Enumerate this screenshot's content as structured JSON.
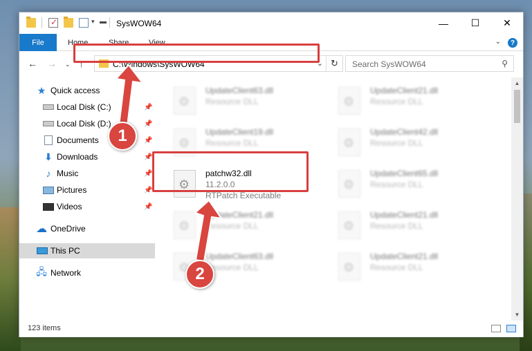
{
  "window": {
    "title": "SysWOW64"
  },
  "ribbon": {
    "file_label": "File",
    "tabs": [
      "Home",
      "Share",
      "View"
    ]
  },
  "address": {
    "path": "C:\\Windows\\SysWOW64"
  },
  "search": {
    "placeholder": "Search SysWOW64"
  },
  "sidebar": {
    "quick_access": "Quick access",
    "items": [
      {
        "label": "Local Disk (C:)",
        "icon": "disk-icon"
      },
      {
        "label": "Local Disk (D:)",
        "icon": "disk-icon"
      },
      {
        "label": "Documents",
        "icon": "documents-icon"
      },
      {
        "label": "Downloads",
        "icon": "downloads-icon"
      },
      {
        "label": "Music",
        "icon": "music-icon"
      },
      {
        "label": "Pictures",
        "icon": "pictures-icon"
      },
      {
        "label": "Videos",
        "icon": "videos-icon"
      }
    ],
    "onedrive": "OneDrive",
    "this_pc": "This PC",
    "network": "Network"
  },
  "files": {
    "left": [
      {
        "name": "UpdateClient63.dll",
        "desc": "Resource DLL"
      },
      {
        "name": "UpdateClient19.dll",
        "desc": "Resource DLL"
      },
      {
        "name": "patchw32.dll",
        "version": "11.2.0.0",
        "desc": "RTPatch Executable"
      },
      {
        "name": "UpdateClient21.dll",
        "desc": "Resource DLL"
      },
      {
        "name": "UpdateClient63.dll",
        "desc": "Resource DLL"
      }
    ],
    "right": [
      {
        "name": "UpdateClient21.dll",
        "desc": "Resource DLL"
      },
      {
        "name": "UpdateClient42.dll",
        "desc": "Resource DLL"
      },
      {
        "name": "UpdateClient65.dll",
        "desc": "Resource DLL"
      },
      {
        "name": "UpdateClient21.dll",
        "desc": "Resource DLL"
      },
      {
        "name": "UpdateClient21.dll",
        "desc": "Resource DLL"
      }
    ]
  },
  "status": {
    "items_count": "123 items"
  },
  "callouts": [
    "1",
    "2"
  ],
  "colors": {
    "accent": "#1979ca",
    "highlight": "#d83f3f",
    "selected": "#d9d9d9"
  }
}
